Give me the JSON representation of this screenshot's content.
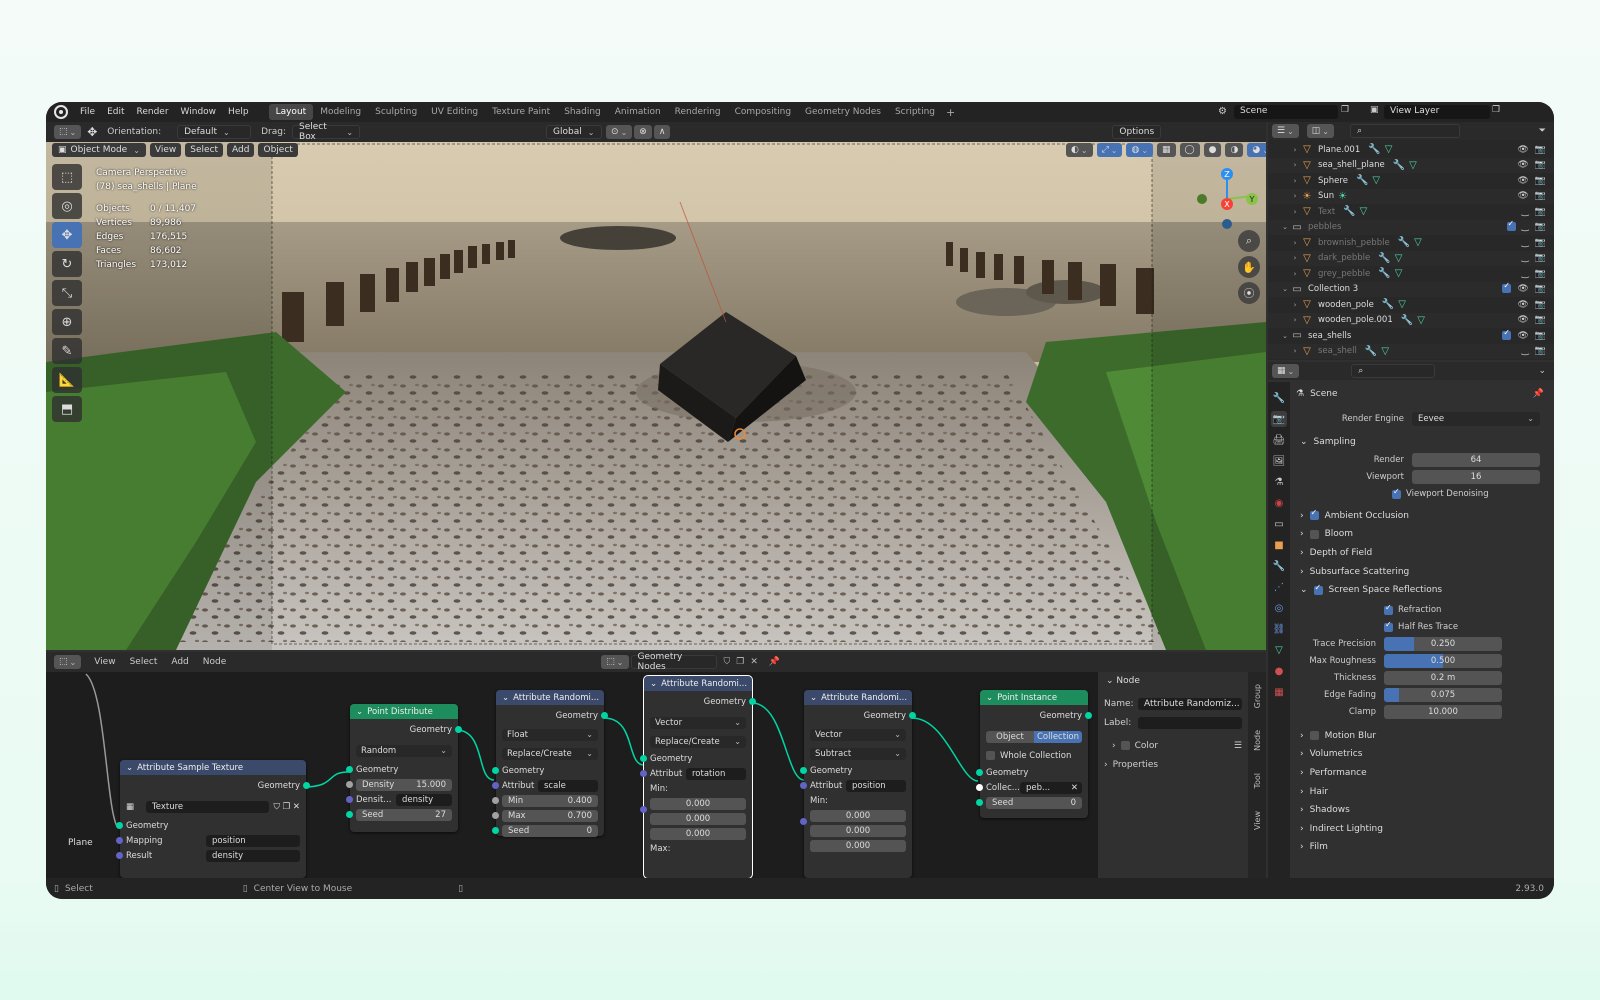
{
  "app": {
    "menus": [
      "File",
      "Edit",
      "Render",
      "Window",
      "Help"
    ],
    "workspaces": [
      "Layout",
      "Modeling",
      "Sculpting",
      "UV Editing",
      "Texture Paint",
      "Shading",
      "Animation",
      "Rendering",
      "Compositing",
      "Geometry Nodes",
      "Scripting"
    ],
    "scene": "Scene",
    "view_layer": "View Layer"
  },
  "viewport_header": {
    "orientation_label": "Orientation:",
    "orientation": "Default",
    "drag_label": "Drag:",
    "drag": "Select Box",
    "transform": "Global",
    "options": "Options"
  },
  "viewport_menu": {
    "mode": "Object Mode",
    "items": [
      "View",
      "Select",
      "Add",
      "Object"
    ]
  },
  "viewport_info": {
    "line1": "Camera Perspective",
    "line2": "(78) sea_shells | Plane",
    "stats": [
      {
        "k": "Objects",
        "v": "0 / 11,407"
      },
      {
        "k": "Vertices",
        "v": "89,986"
      },
      {
        "k": "Edges",
        "v": "176,515"
      },
      {
        "k": "Faces",
        "v": "86,602"
      },
      {
        "k": "Triangles",
        "v": "173,012"
      }
    ]
  },
  "gizmo": {
    "x": "X",
    "y": "Y",
    "z": "Z"
  },
  "node_editor": {
    "menus": [
      "View",
      "Select",
      "Add",
      "Node"
    ],
    "tree": "Geometry Nodes",
    "frame_label": "Plane",
    "nodes": {
      "tex": {
        "title": "Attribute Sample Texture",
        "out": "Geometry",
        "texture": "Texture",
        "in_geom": "Geometry",
        "mapping": "Mapping",
        "mapping_val": "position",
        "result": "Result",
        "result_val": "density"
      },
      "pd": {
        "title": "Point Distribute",
        "out": "Geometry",
        "mode": "Random",
        "in_geom": "Geometry",
        "density_label": "Density",
        "density": "15.000",
        "densit_label": "Densit...",
        "densit_val": "density",
        "seed_label": "Seed",
        "seed": "27"
      },
      "ar1": {
        "title": "Attribute Randomi...",
        "out": "Geometry",
        "type": "Float",
        "op": "Replace/Create",
        "in_geom": "Geometry",
        "attr_label": "Attribut",
        "attr": "scale",
        "min_label": "Min",
        "min": "0.400",
        "max_label": "Max",
        "max": "0.700",
        "seed_label": "Seed",
        "seed": "0"
      },
      "ar2": {
        "title": "Attribute Randomi...",
        "out": "Geometry",
        "type": "Vector",
        "op": "Replace/Create",
        "in_geom": "Geometry",
        "attr_label": "Attribut",
        "attr": "rotation",
        "min_label": "Min:",
        "v1": "0.000",
        "v2": "0.000",
        "v3": "0.000",
        "max_label": "Max:"
      },
      "ar3": {
        "title": "Attribute Randomi...",
        "out": "Geometry",
        "type": "Vector",
        "op": "Subtract",
        "in_geom": "Geometry",
        "attr_label": "Attribut",
        "attr": "position",
        "min_label": "Min:",
        "v1": "0.000",
        "v2": "0.000",
        "v3": "0.000"
      },
      "pi": {
        "title": "Point Instance",
        "out": "Geometry",
        "opt1": "Object",
        "opt2": "Collection",
        "whole": "Whole Collection",
        "in_geom": "Geometry",
        "collec": "Collec...",
        "collec_val": "peb...",
        "seed_label": "Seed",
        "seed": "0"
      }
    },
    "panel": {
      "section": "Node",
      "name_label": "Name:",
      "name": "Attribute Randomiz...",
      "label_label": "Label:",
      "color": "Color",
      "properties": "Properties"
    },
    "tabs": [
      "Group",
      "Node",
      "Tool",
      "View"
    ]
  },
  "outliner": {
    "rows": [
      {
        "name": "Plane.001",
        "type": "mesh",
        "depth": 1,
        "dim": false
      },
      {
        "name": "sea_shell_plane",
        "type": "mesh",
        "depth": 1,
        "dim": false
      },
      {
        "name": "Sphere",
        "type": "mesh",
        "depth": 1,
        "dim": false
      },
      {
        "name": "Sun",
        "type": "light",
        "depth": 1,
        "dim": false
      },
      {
        "name": "Text",
        "type": "mesh",
        "depth": 1,
        "dim": true
      },
      {
        "name": "pebbles",
        "type": "coll",
        "depth": 0,
        "dim": true
      },
      {
        "name": "brownish_pebble",
        "type": "mesh",
        "depth": 1,
        "dim": true
      },
      {
        "name": "dark_pebble",
        "type": "mesh",
        "depth": 1,
        "dim": true
      },
      {
        "name": "grey_pebble",
        "type": "mesh",
        "depth": 1,
        "dim": true
      },
      {
        "name": "Collection 3",
        "type": "coll",
        "depth": 0,
        "dim": false
      },
      {
        "name": "wooden_pole",
        "type": "mesh",
        "depth": 1,
        "dim": false
      },
      {
        "name": "wooden_pole.001",
        "type": "mesh",
        "depth": 1,
        "dim": false
      },
      {
        "name": "sea_shells",
        "type": "coll",
        "depth": 0,
        "dim": false
      },
      {
        "name": "sea_shell",
        "type": "mesh",
        "depth": 1,
        "dim": true
      }
    ]
  },
  "properties": {
    "scene": "Scene",
    "render_engine_label": "Render Engine",
    "render_engine": "Eevee",
    "sampling": "Sampling",
    "render_label": "Render",
    "render": "64",
    "viewport_label": "Viewport",
    "viewport": "16",
    "denoise": "Viewport Denoising",
    "ao": "Ambient Occlusion",
    "bloom": "Bloom",
    "dof": "Depth of Field",
    "sss": "Subsurface Scattering",
    "ssr": "Screen Space Reflections",
    "refraction": "Refraction",
    "halfres": "Half Res Trace",
    "trace_label": "Trace Precision",
    "trace": "0.250",
    "trace_frac": 0.25,
    "rough_label": "Max Roughness",
    "rough": "0.500",
    "rough_frac": 0.5,
    "thick_label": "Thickness",
    "thick": "0.2 m",
    "edge_label": "Edge Fading",
    "edge": "0.075",
    "edge_frac": 0.13,
    "clamp_label": "Clamp",
    "clamp": "10.000",
    "more": [
      "Motion Blur",
      "Volumetrics",
      "Performance",
      "Hair",
      "Shadows",
      "Indirect Lighting",
      "Film"
    ]
  },
  "status": {
    "select": "Select",
    "center": "Center View to Mouse",
    "version": "2.93.0"
  }
}
